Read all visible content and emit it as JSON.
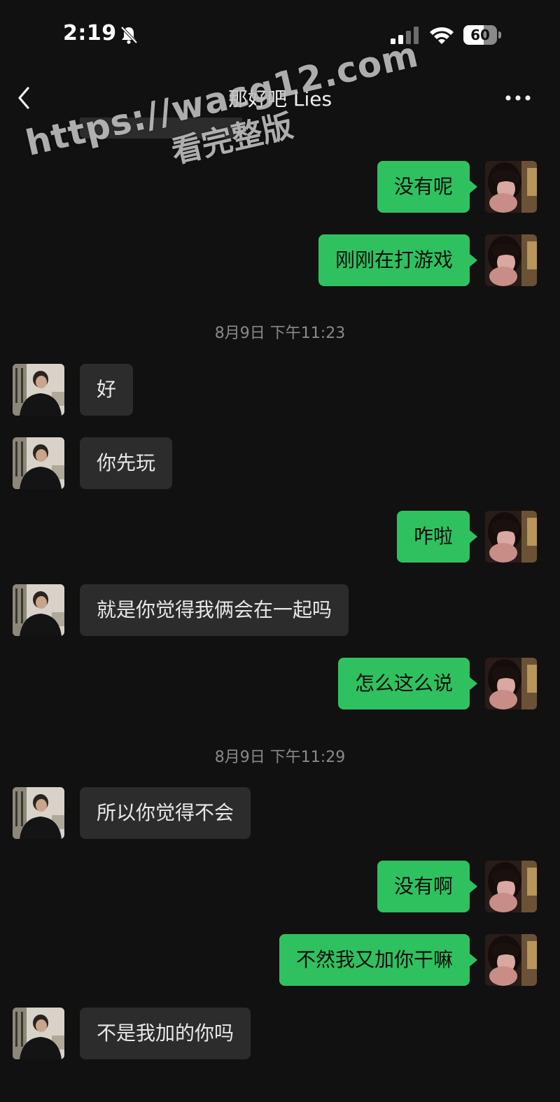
{
  "status_bar": {
    "time": "2:19",
    "battery_level": "60",
    "battery_fraction": 0.6,
    "icons": [
      "bell-off-icon",
      "signal-icon",
      "wifi-icon",
      "battery-icon"
    ]
  },
  "nav": {
    "title": "那好吧 Lies",
    "back_icon": "chevron-left-icon",
    "more_icon": "more-dots-icon"
  },
  "watermark": {
    "line1": "https://wacg12.com",
    "line2": "看完整版"
  },
  "messages": [
    {
      "type": "sent",
      "text": "没有呢"
    },
    {
      "type": "sent",
      "text": "刚刚在打游戏"
    },
    {
      "type": "timestamp",
      "text": "8月9日 下午11:23"
    },
    {
      "type": "received",
      "text": "好"
    },
    {
      "type": "received",
      "text": "你先玩"
    },
    {
      "type": "sent",
      "text": "咋啦"
    },
    {
      "type": "received",
      "text": "就是你觉得我俩会在一起吗"
    },
    {
      "type": "sent",
      "text": "怎么这么说"
    },
    {
      "type": "timestamp",
      "text": "8月9日 下午11:29"
    },
    {
      "type": "received",
      "text": "所以你觉得不会"
    },
    {
      "type": "sent",
      "text": "没有啊"
    },
    {
      "type": "sent",
      "text": "不然我又加你干嘛"
    },
    {
      "type": "received",
      "text": "不是我加的你吗"
    }
  ],
  "colors": {
    "background": "#111111",
    "sent_bubble": "#2fc15f",
    "received_bubble": "#2c2c2c",
    "timestamp_text": "#8a8a8a"
  }
}
